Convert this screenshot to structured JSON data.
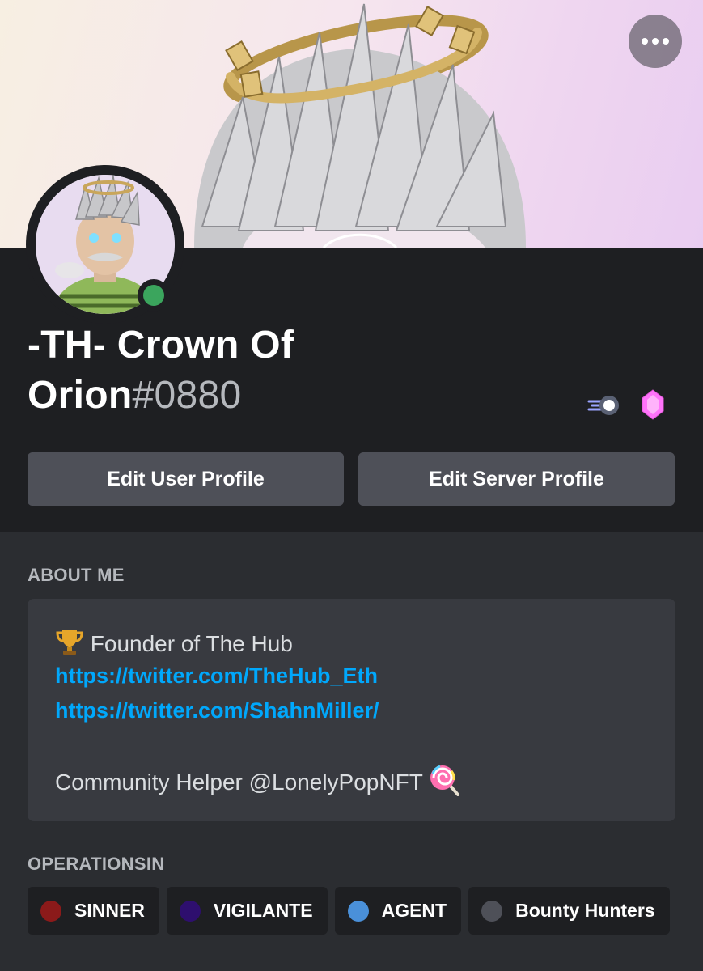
{
  "profile": {
    "display_name": "-TH- Crown Of Orion",
    "discriminator": "#0880",
    "status": "online"
  },
  "actions": {
    "more_label": "More options",
    "edit_user_label": "Edit User Profile",
    "edit_server_label": "Edit Server Profile"
  },
  "badges": [
    {
      "icon": "hypesquad-speed-badge-icon"
    },
    {
      "icon": "nitro-gem-badge-icon"
    }
  ],
  "about": {
    "title": "ABOUT ME",
    "line1": "Founder of The Hub",
    "line1_icon": "trophy-icon",
    "link1": "https://twitter.com/TheHub_Eth",
    "link2": "https://twitter.com/ShahnMiller/",
    "line3": "Community Helper @LonelyPopNFT",
    "line3_icon": "lollipop-icon"
  },
  "roles_section": {
    "title": "OPERATIONSIN",
    "roles": [
      {
        "label": "SINNER",
        "color": "#8b1a1a"
      },
      {
        "label": "VIGILANTE",
        "color": "#2e0f6e"
      },
      {
        "label": "AGENT",
        "color": "#4a90d9"
      },
      {
        "label": "Bounty Hunters",
        "color": "#4e5058"
      }
    ]
  },
  "colors": {
    "background": "#2b2d31",
    "header": "#1e1f22",
    "link": "#00a8fc",
    "online": "#3ba55d",
    "button": "#4e5058"
  }
}
